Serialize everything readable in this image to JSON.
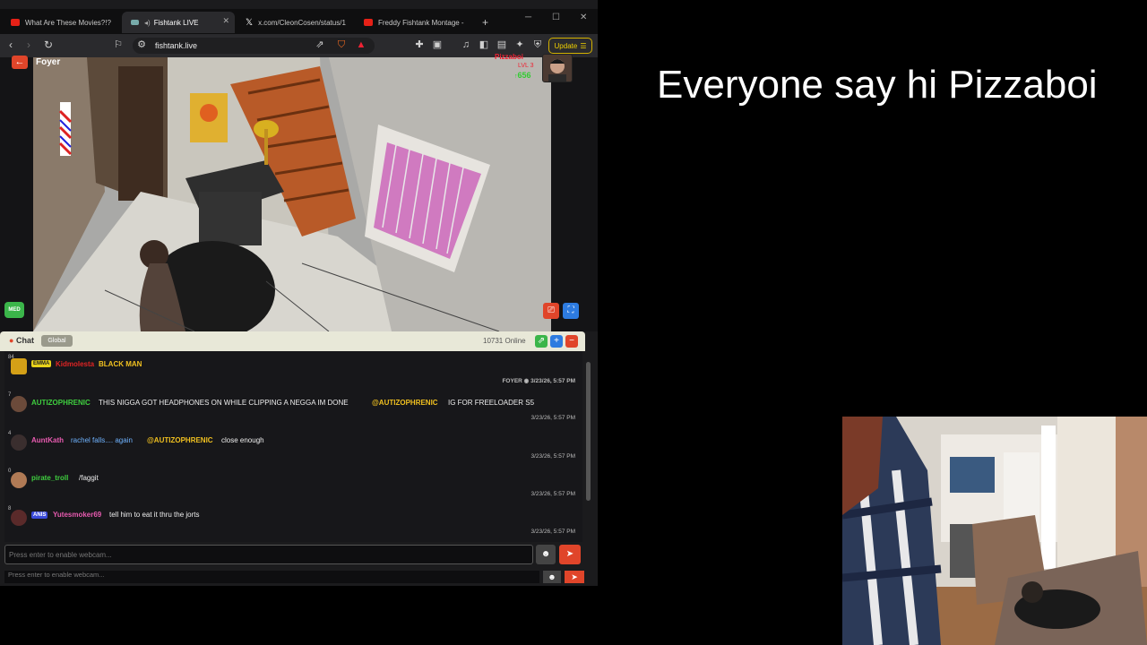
{
  "browser": {
    "tabs": [
      {
        "title": "What Are These Movies?!?",
        "favicon": "youtube-icon",
        "active": false
      },
      {
        "title": "Fishtank LIVE",
        "favicon": "fishtank-icon",
        "active": true
      },
      {
        "title": "x.com/CleonCosen/status/1",
        "favicon": "x-icon",
        "active": false
      },
      {
        "title": "Freddy Fishtank Montage -",
        "favicon": "youtube-icon",
        "active": false
      }
    ],
    "new_tab": "+",
    "url": "fishtank.live",
    "update_label": "Update"
  },
  "stream": {
    "camera_name": "Foyer",
    "streamer_name": "Pizzaboi",
    "streamer_level": "LVL 3",
    "streamer_count": "656",
    "quality_badge": "MED"
  },
  "chat": {
    "title": "Chat",
    "scope": "Global",
    "online": "10731 Online",
    "messages": [
      {
        "num": "84",
        "badge": "EMMA",
        "badge_color": "#e8d21a",
        "username": "Kidmolesta",
        "user_color": "#e02424",
        "text": "BLACK MAN",
        "text_color": "#f0c020",
        "timestamp": "FOYER ◉ 3/23/26, 5:57 PM"
      },
      {
        "num": "7",
        "badge": "",
        "username": "AUTIZOPHRENIC",
        "user_color": "#3fcf3f",
        "text": "THIS NIGGA GOT HEADPHONES ON WHILE CLIPPING A NEGGA IM DONE",
        "mention": "@AUTIZOPHRENIC",
        "mention_color": "#f0c020",
        "extra": "IG FOR FREELOADER S5",
        "timestamp": "3/23/26, 5:57 PM"
      },
      {
        "num": "4",
        "badge": "",
        "username": "AuntKath",
        "user_color": "#e85bb0",
        "text": "rachel falls.... again",
        "text_color": "#6fb3ff",
        "mention": "@AUTIZOPHRENIC",
        "mention_color": "#f0c020",
        "extra": "close enough",
        "timestamp": "3/23/26, 5:57 PM"
      },
      {
        "num": "0",
        "badge": "",
        "username": "pirate_troll",
        "user_color": "#3fcf3f",
        "text": "/faggit",
        "timestamp": "3/23/26, 5:57 PM"
      },
      {
        "num": "8",
        "badge": "ANIS",
        "badge_color": "#3a4ad8",
        "username": "Yutesmoker69",
        "user_color": "#e85bb0",
        "text": "tell him to eat it thru the jorts",
        "timestamp": "3/23/26, 5:57 PM"
      }
    ],
    "input_placeholder": "Press enter to enable webcam...",
    "input_placeholder_2": "Press enter to enable webcam..."
  },
  "caption": "Everyone say hi Pizzaboi"
}
